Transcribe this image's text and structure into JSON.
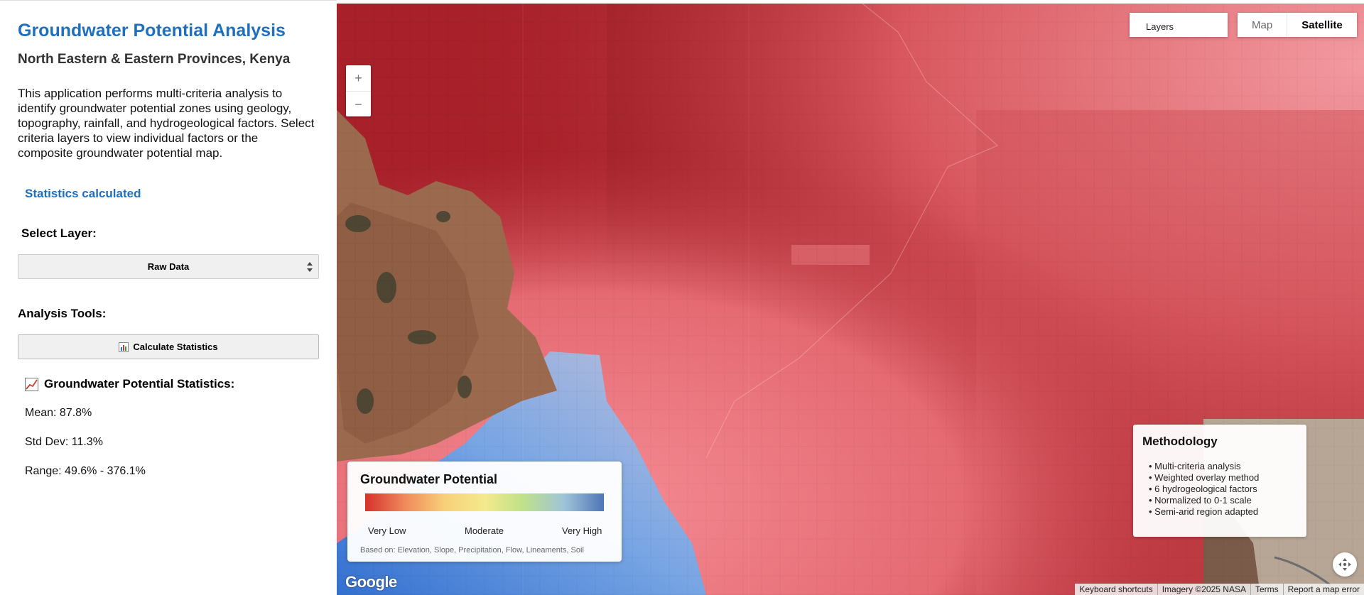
{
  "sidebar": {
    "title": "Groundwater Potential Analysis",
    "subtitle": "North Eastern & Eastern Provinces, Kenya",
    "description": "This application performs multi-criteria analysis to identify groundwater potential zones using geology, topography, rainfall, and hydrogeological factors. Select criteria layers to view individual factors or the composite groundwater potential map.",
    "status": "Statistics calculated",
    "select_label": "Select Layer:",
    "select_value": "Raw Data",
    "tools_label": "Analysis Tools:",
    "calc_button": "Calculate Statistics",
    "stats_title": "Groundwater Potential Statistics:",
    "stats": {
      "mean": "Mean: 87.8%",
      "std": "Std Dev: 11.3%",
      "range": "Range: 49.6% - 376.1%"
    }
  },
  "map": {
    "zoom_in": "+",
    "zoom_out": "−",
    "layers_label": "Layers",
    "map_type": {
      "map": "Map",
      "satellite": "Satellite",
      "selected": "Satellite"
    },
    "legend": {
      "title": "Groundwater Potential",
      "low": "Very Low",
      "mid": "Moderate",
      "high": "Very High",
      "note": "Based on: Elevation, Slope, Precipitation, Flow, Lineaments, Soil"
    },
    "methodology": {
      "title": "Methodology",
      "items": [
        "• Multi-criteria analysis",
        "• Weighted overlay method",
        "• 6 hydrogeological factors",
        "• Normalized to 0-1 scale",
        "• Semi-arid region adapted"
      ]
    },
    "google_logo": "Google",
    "attribution": [
      "Keyboard shortcuts",
      "Imagery ©2025 NASA",
      "Terms",
      "Report a map error"
    ]
  },
  "colors": {
    "title_blue": "#1f6fbf",
    "map_red": "#a8212a",
    "map_pink": "#ef8088",
    "map_blue": "#3f8fe0"
  }
}
